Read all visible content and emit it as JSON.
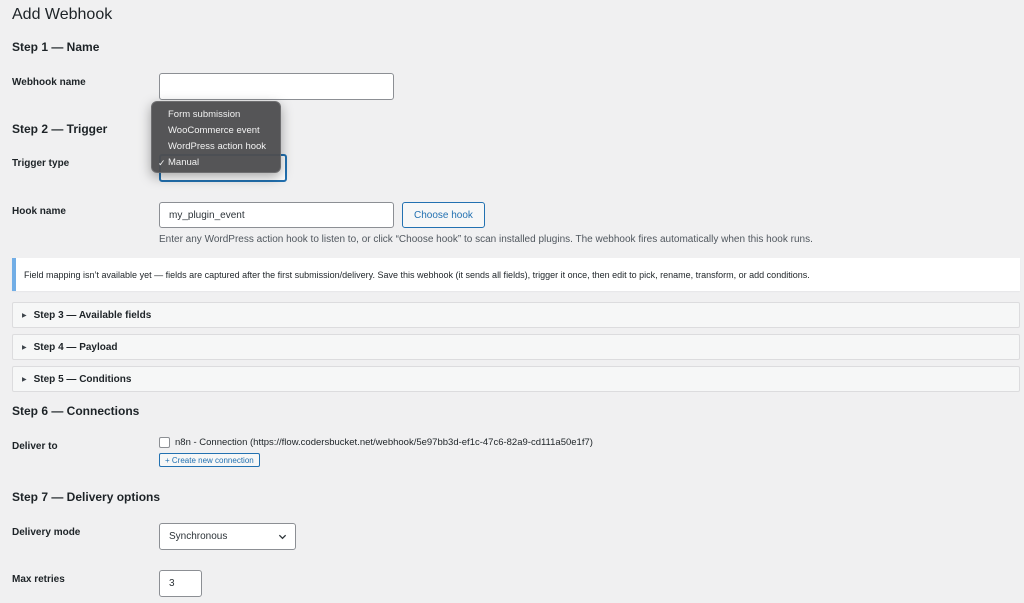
{
  "page": {
    "title": "Add Webhook"
  },
  "step1": {
    "title": "Step 1 — Name",
    "webhook_name_label": "Webhook name",
    "webhook_name_value": ""
  },
  "step2": {
    "title": "Step 2 — Trigger",
    "trigger_type_label": "Trigger type",
    "trigger_options": [
      {
        "label": "Form submission",
        "selected": false
      },
      {
        "label": "WooCommerce event",
        "selected": false
      },
      {
        "label": "WordPress action hook",
        "selected": false
      },
      {
        "label": "Manual",
        "selected": true
      }
    ],
    "check_mark": "✓",
    "hook_name_label": "Hook name",
    "hook_name_value": "my_plugin_event",
    "choose_hook_label": "Choose hook",
    "hook_help": "Enter any WordPress action hook to listen to, or click “Choose hook” to scan installed plugins. The webhook fires automatically when this hook runs."
  },
  "notice": {
    "text": "Field mapping isn’t available yet — fields are captured after the first submission/delivery. Save this webhook (it sends all fields), trigger it once, then edit to pick, rename, transform, or add conditions."
  },
  "collapsed_sections": [
    {
      "title": "Step 3 — Available fields"
    },
    {
      "title": "Step 4 — Payload"
    },
    {
      "title": "Step 5 — Conditions"
    }
  ],
  "step6": {
    "title": "Step 6 — Connections",
    "deliver_to_label": "Deliver to",
    "connection_label": "n8n - Connection (https://flow.codersbucket.net/webhook/5e97bb3d-ef1c-47c6-82a9-cd111a50e1f7)",
    "connection_checked": false,
    "create_connection_label": "+ Create new connection"
  },
  "step7": {
    "title": "Step 7 — Delivery options",
    "delivery_mode_label": "Delivery mode",
    "delivery_mode_value": "Synchronous",
    "max_retries_label": "Max retries",
    "max_retries_value": "3"
  },
  "colors": {
    "background": "#f0f0f1",
    "accent": "#2271b1",
    "notice_border": "#72aee6",
    "dropdown_bg": "#4e4e50"
  }
}
